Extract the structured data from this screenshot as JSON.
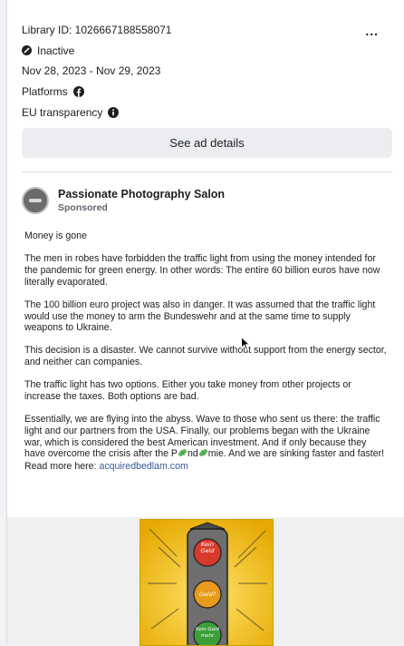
{
  "meta": {
    "library_id": "Library ID: 1026667188558071",
    "status": "Inactive",
    "date_range": "Nov 28, 2023 - Nov 29, 2023",
    "platforms_label": "Platforms",
    "eu_label": "EU transparency"
  },
  "more_label": "...",
  "details_button": "See ad details",
  "advertiser": {
    "name": "Passionate Photography Salon",
    "sponsored": "Sponsored"
  },
  "ad_text": {
    "p1": "Money is gone",
    "p2": "The men in robes have forbidden the traffic light from using the money intended for the pandemic for green energy. In other words: The entire 60 billion euros have now literally evaporated.",
    "p3": "The 100 billion euro project was also in danger. It was assumed that the traffic light would use the money to arm the Bundeswehr and at the same time to supply weapons to Ukraine.",
    "p4": "This decision is a disaster. We cannot survive without support from the energy sector, and neither can companies.",
    "p5": "The traffic light has two options. Either you take money from other projects or increase the taxes. Both options are bad.",
    "p6a": "Essentially, we are flying into the abyss. Wave to those who sent us there: the traffic light and our partners from the USA. Finally, our problems began with the Ukraine war, which is considered the best American investment. And if only because they have overcome the crisis after the P",
    "p6b": "nd",
    "p6c": "mie. And we are sinking faster and faster! Read more here: ",
    "link": "acquiredbedlam.com"
  },
  "media": {
    "light_red": "Kein Geld",
    "light_yellow": "Geld?",
    "light_green": "Kein Geld mehr"
  },
  "colors": {
    "link": "#385898",
    "button_bg": "#ebedf0",
    "pill_green": "#5cb85c"
  }
}
